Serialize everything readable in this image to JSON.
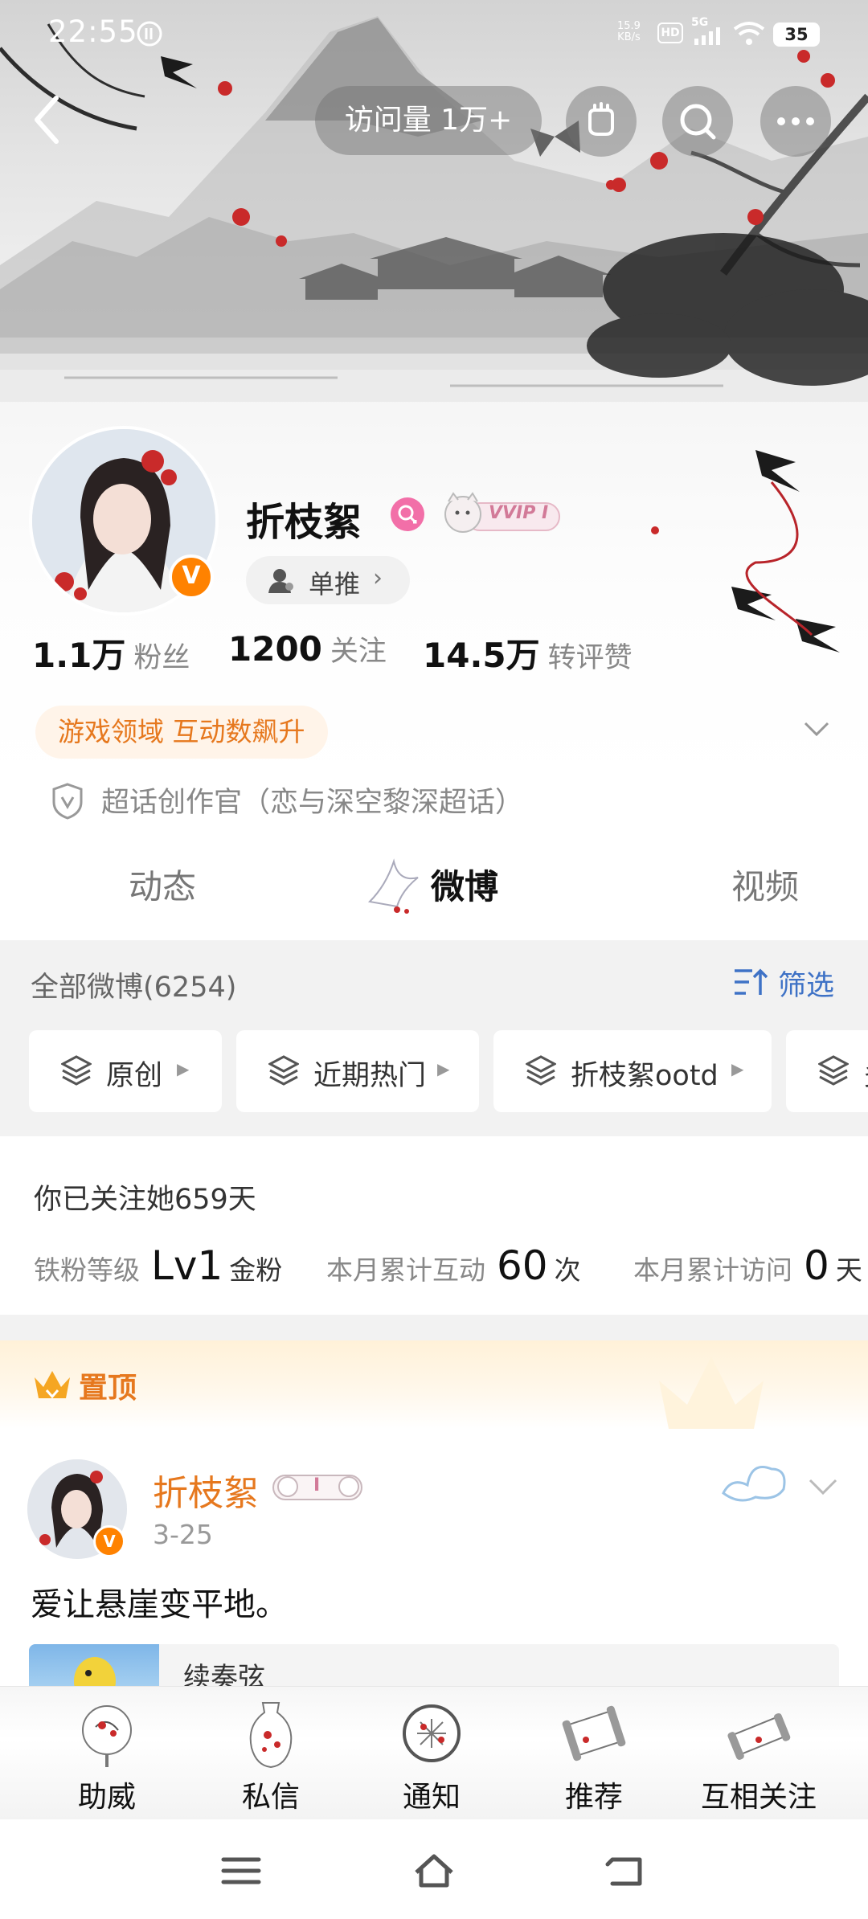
{
  "status_bar": {
    "time": "22:55",
    "net_speed_top": "15.9",
    "net_speed_bottom": "KB/s",
    "hd_label": "HD",
    "signal_label": "5G",
    "battery": "35"
  },
  "top_nav": {
    "visit_count": "访问量 1万+",
    "icons": [
      "back-icon",
      "fist-bump-icon",
      "search-icon",
      "more-icon"
    ]
  },
  "profile": {
    "name": "折枝絮",
    "verified_badge": "V",
    "vip_label": "VVIP I",
    "follow_tag": "单推",
    "stats": [
      {
        "value": "1.1万",
        "label": "粉丝"
      },
      {
        "value": "1200",
        "label": "关注"
      },
      {
        "value": "14.5万",
        "label": "转评赞"
      }
    ],
    "honor": "游戏领域 互动数飙升",
    "supertopic": "超话创作官（恋与深空黎深超话）"
  },
  "tabs": [
    {
      "label": "动态",
      "active": false
    },
    {
      "label": "微博",
      "active": true
    },
    {
      "label": "视频",
      "active": false
    }
  ],
  "feed": {
    "title": "全部微博(6254)",
    "filter_label": "筛选",
    "chips": [
      "原创",
      "近期热门",
      "折枝絮ootd",
      "多"
    ]
  },
  "fan_card": {
    "follow_days": "你已关注她659天",
    "level_key": "铁粉等级",
    "level_value": "Lv1",
    "level_suffix": "金粉",
    "interact_key": "本月累计互动",
    "interact_value": "60",
    "interact_suffix": "次",
    "visit_key": "本月累计访问",
    "visit_value": "0",
    "visit_suffix": "天"
  },
  "pinned": {
    "label": "置顶",
    "author": "折枝絮",
    "author_tag": "I",
    "date": "3-25",
    "text": "爱让悬崖变平地。",
    "card_text": "续奏弦"
  },
  "action_bar": [
    {
      "label": "助威",
      "icon": "fan-icon"
    },
    {
      "label": "私信",
      "icon": "vase-icon"
    },
    {
      "label": "通知",
      "icon": "window-icon"
    },
    {
      "label": "推荐",
      "icon": "scroll-icon"
    },
    {
      "label": "互相关注",
      "icon": "scroll-open-icon"
    }
  ],
  "colors": {
    "accent_orange": "#e6781e",
    "link_blue": "#3e72c6",
    "verified_orange": "#ff8200",
    "female_pink": "#f26fa8"
  }
}
